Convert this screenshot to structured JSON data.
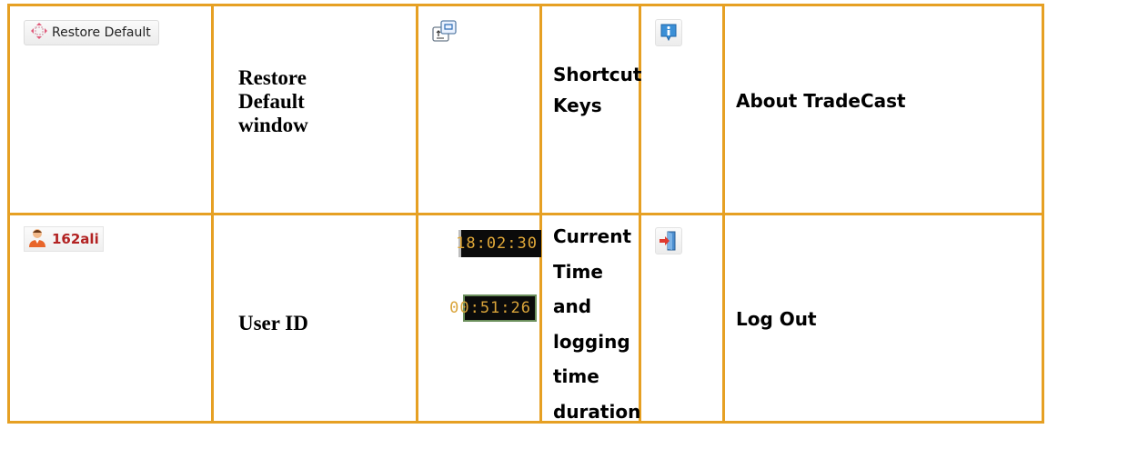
{
  "row1": {
    "restore": {
      "button_label": "Restore Default",
      "description": [
        "Restore",
        "Default",
        "window"
      ],
      "icon": "restore-arrows-icon"
    },
    "shortcut": {
      "description": [
        "Shortcut",
        "Keys"
      ],
      "icon": "keyboard-shortcut-icon"
    },
    "about": {
      "description": "About TradeCast",
      "icon": "info-icon"
    }
  },
  "row2": {
    "user": {
      "user_id_value": "162ali",
      "description": "User ID",
      "icon": "user-avatar-icon"
    },
    "time": {
      "current_time": "18:02:30",
      "logging_time": "00:51:26",
      "description": [
        "Current",
        "Time and",
        "logging",
        "time",
        "duration"
      ]
    },
    "logout": {
      "description": "Log Out",
      "icon": "logout-door-icon"
    }
  },
  "colors": {
    "border": "#E6A023",
    "user_id_text": "#B22222",
    "clock_digits": "#E0A838"
  }
}
